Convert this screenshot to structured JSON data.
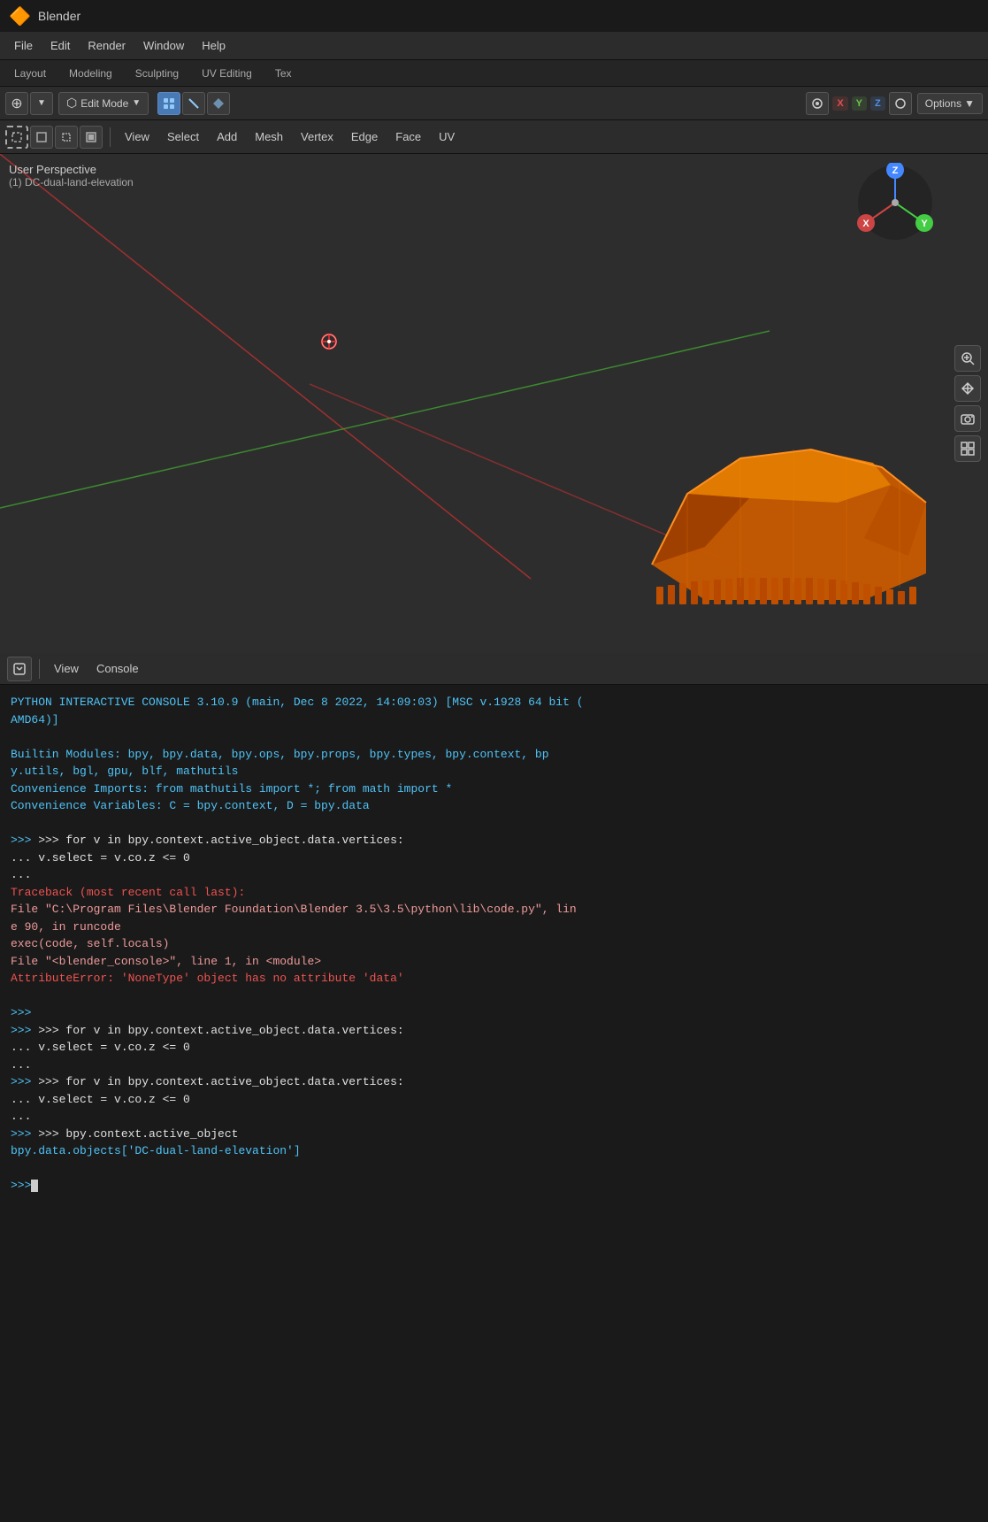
{
  "titlebar": {
    "title": "Blender",
    "logo": "🔶"
  },
  "menubar": {
    "items": [
      "File",
      "Edit",
      "Render",
      "Window",
      "Help"
    ]
  },
  "workspacetabs": {
    "tabs": [
      "Layout",
      "Modeling",
      "Sculpting",
      "UV Editing",
      "Tex"
    ]
  },
  "viewport": {
    "mode": "Edit Mode",
    "perspective": "User Perspective",
    "object": "(1) DC-dual-land-elevation",
    "header2": {
      "items": [
        "View",
        "Select",
        "Add",
        "Mesh",
        "Vertex",
        "Edge",
        "Face",
        "UV"
      ]
    },
    "axes": {
      "x_label": "X",
      "y_label": "Y",
      "z_label": "Z"
    },
    "options_btn": "Options",
    "rightIcons": [
      "🔍",
      "✋",
      "🎥",
      "⊞"
    ]
  },
  "console": {
    "view_label": "View",
    "console_label": "Console",
    "startup_line": "PYTHON INTERACTIVE CONSOLE 3.10.9 (main, Dec  8 2022, 14:09:03) [MSC v.1928 64 bit (",
    "startup_line2": "AMD64)]",
    "builtin_line": "Builtin Modules:        bpy, bpy.data, bpy.ops, bpy.props, bpy.types, bpy.context, bp",
    "builtin_line2": "y.utils, bgl, gpu, blf, mathutils",
    "convenience_line": "Convenience Imports:   from mathutils import *; from math import *",
    "convenience_vars": "Convenience Variables: C = bpy.context, D = bpy.data",
    "commands": [
      {
        "type": "prompt",
        "text": ">>> for v in bpy.context.active_object.data.vertices:"
      },
      {
        "type": "continuation",
        "text": "...     v.select = v.co.z <= 0"
      },
      {
        "type": "continuation",
        "text": "..."
      },
      {
        "type": "traceback_header",
        "text": "Traceback (most recent call last):"
      },
      {
        "type": "traceback",
        "text": "  File \"C:\\Program Files\\Blender Foundation\\Blender 3.5\\3.5\\python\\lib\\code.py\", lin"
      },
      {
        "type": "traceback",
        "text": "e 90, in runcode"
      },
      {
        "type": "traceback",
        "text": "    exec(code, self.locals)"
      },
      {
        "type": "traceback",
        "text": "  File \"<blender_console>\", line 1, in <module>"
      },
      {
        "type": "error",
        "text": "AttributeError: 'NoneType' object has no attribute 'data'"
      },
      {
        "type": "blank"
      },
      {
        "type": "prompt",
        "text": ">>>"
      },
      {
        "type": "prompt",
        "text": ">>> for v in bpy.context.active_object.data.vertices:"
      },
      {
        "type": "continuation",
        "text": "...     v.select = v.co.z <= 0"
      },
      {
        "type": "continuation",
        "text": "..."
      },
      {
        "type": "prompt",
        "text": ">>> for v in bpy.context.active_object.data.vertices:"
      },
      {
        "type": "continuation",
        "text": "...     v.select = v.co.z <= 0"
      },
      {
        "type": "continuation",
        "text": "..."
      },
      {
        "type": "prompt",
        "text": ">>> bpy.context.active_object"
      },
      {
        "type": "result",
        "text": "bpy.data.objects['DC-dual-land-elevation']"
      },
      {
        "type": "blank"
      },
      {
        "type": "input",
        "text": ">>>"
      }
    ]
  }
}
